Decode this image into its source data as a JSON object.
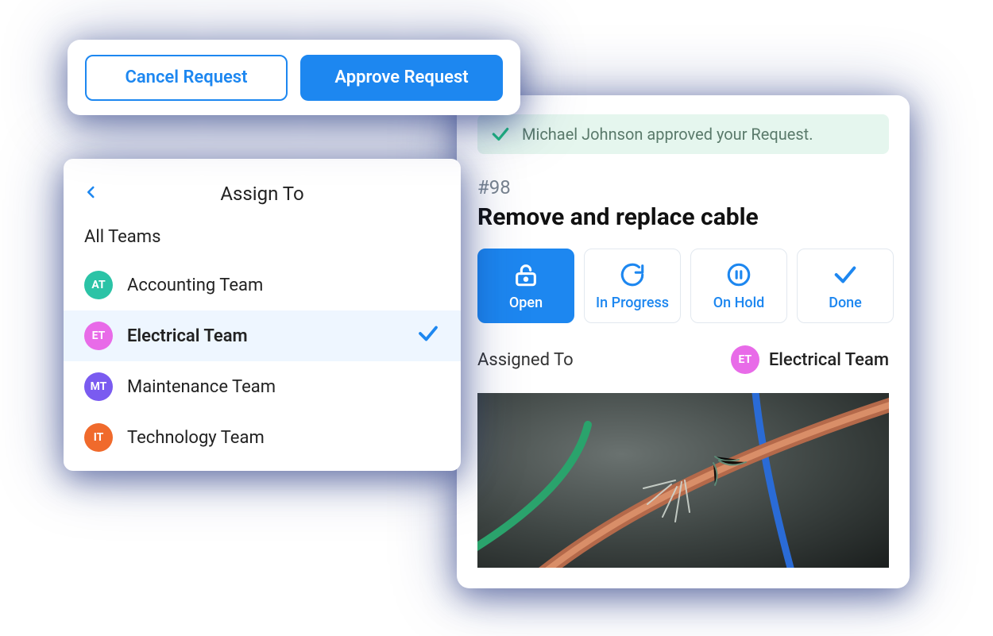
{
  "topButtons": {
    "cancel": "Cancel Request",
    "approve": "Approve Request"
  },
  "detail": {
    "notification": "Michael Johnson approved your Request.",
    "id": "#98",
    "title": "Remove and replace cable",
    "status": {
      "open": "Open",
      "inProgress": "In Progress",
      "onHold": "On Hold",
      "done": "Done"
    },
    "assignedLabel": "Assigned To",
    "assignedTeam": {
      "initials": "ET",
      "name": "Electrical Team"
    }
  },
  "assign": {
    "title": "Assign To",
    "section": "All Teams",
    "teams": [
      {
        "initials": "AT",
        "name": "Accounting Team",
        "selected": false
      },
      {
        "initials": "ET",
        "name": "Electrical Team",
        "selected": true
      },
      {
        "initials": "MT",
        "name": "Maintenance Team",
        "selected": false
      },
      {
        "initials": "IT",
        "name": "Technology Team",
        "selected": false
      }
    ]
  },
  "colors": {
    "primary": "#1d87f0",
    "notifBg": "#e5f6ee",
    "notifCheck": "#22c080",
    "avatar": {
      "AT": "#2bc3a6",
      "ET": "#e86be8",
      "MT": "#7a5bf0",
      "IT": "#f06a2c"
    }
  }
}
